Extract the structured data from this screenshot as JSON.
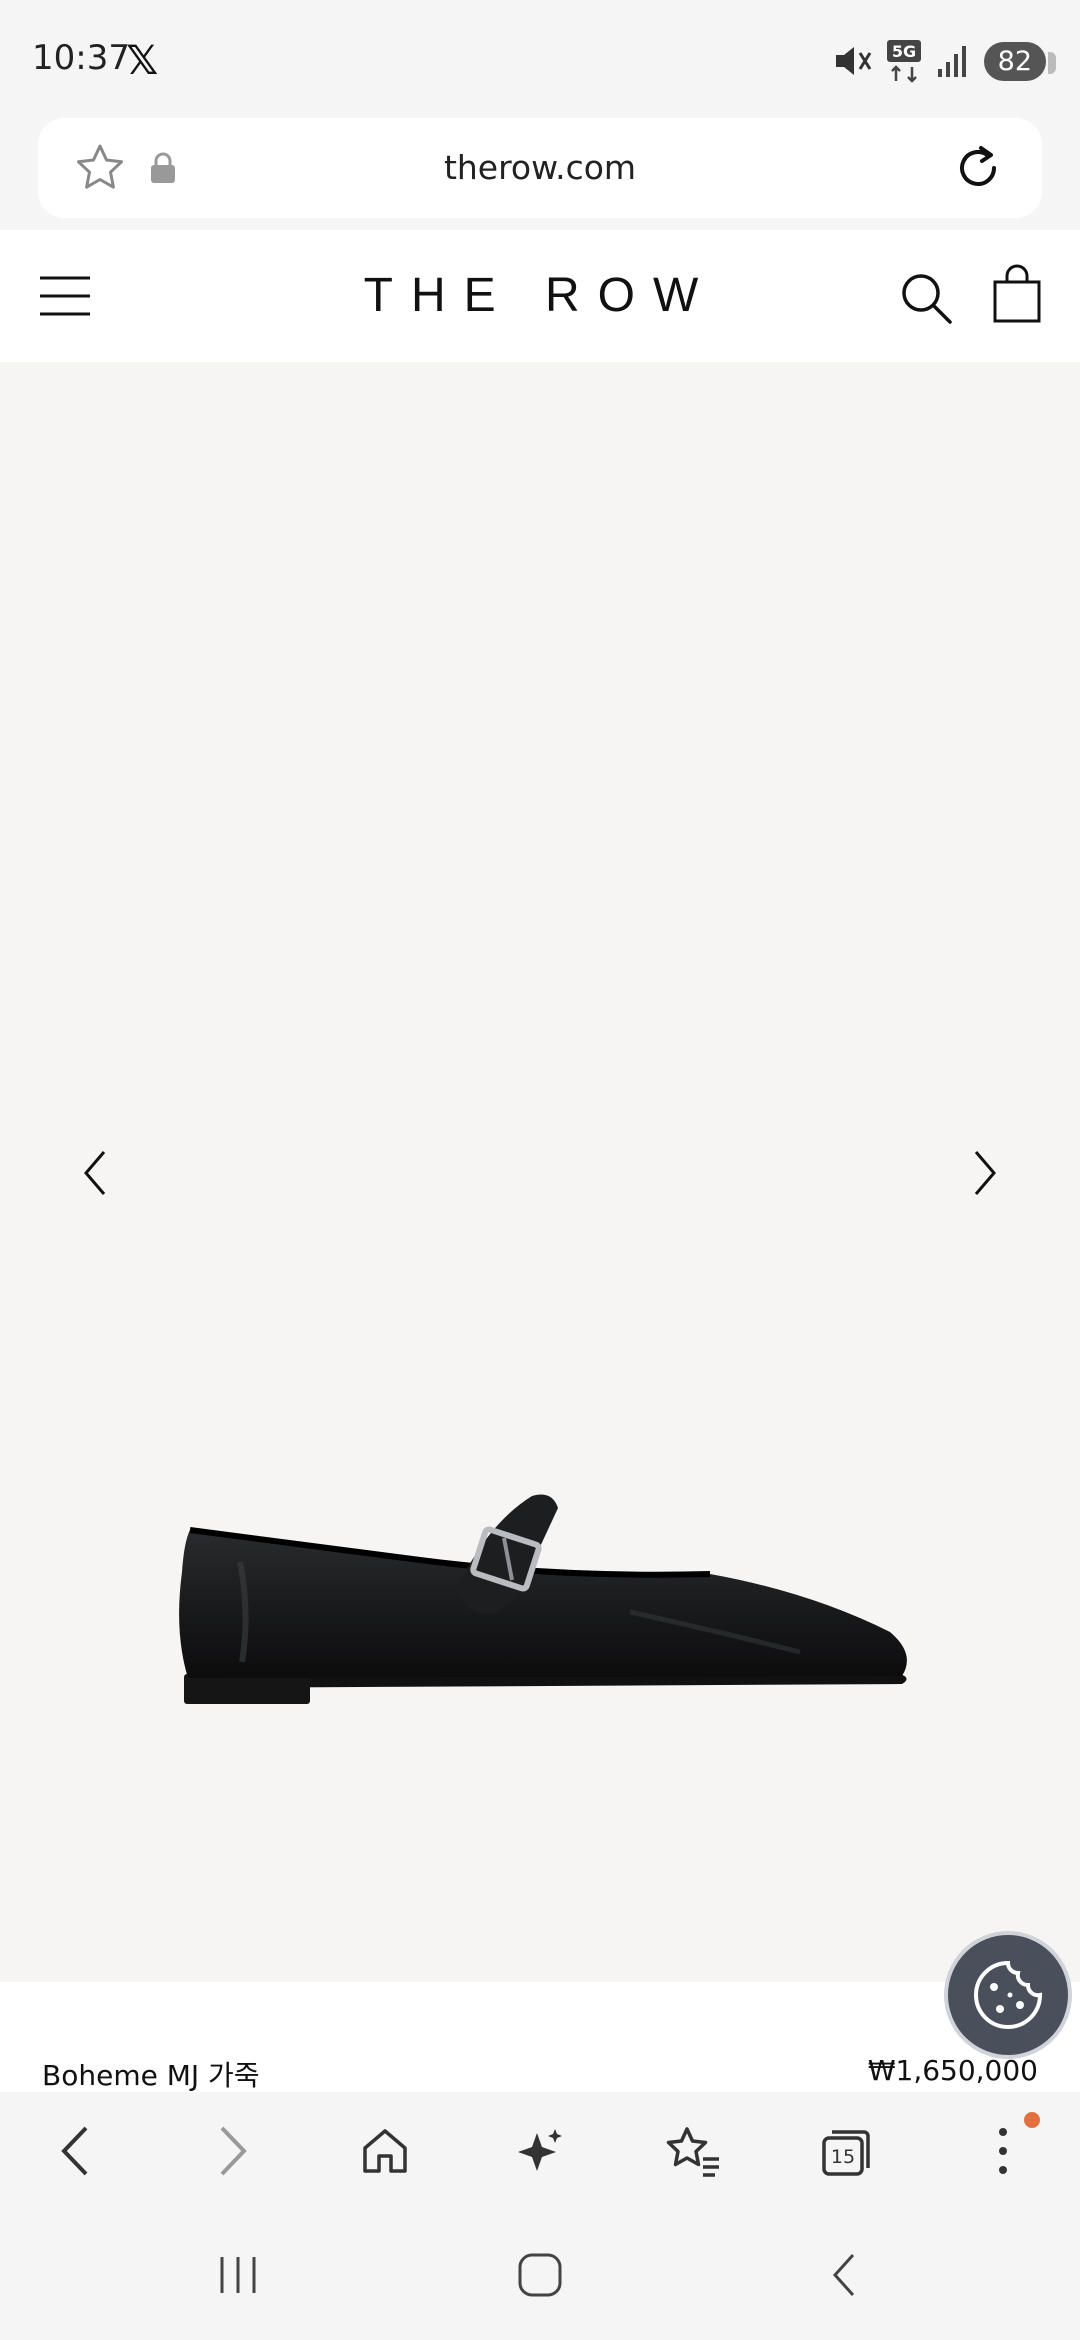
{
  "status_bar": {
    "time": "10:37",
    "app_icon": "x-logo-icon",
    "network": "5G",
    "battery": "82"
  },
  "browser": {
    "url": "therow.com",
    "tab_count": "15"
  },
  "site": {
    "brand": "THE ROW"
  },
  "product": {
    "name": "Boheme MJ 가죽",
    "price": "₩1,650,000",
    "image": "black-leather-mary-jane-flat"
  },
  "colors": {
    "background": "#f5f5f5",
    "gallery_bg": "#f6f5f4",
    "cookie_button": "#4a4f5c",
    "notification_dot": "#e07040"
  }
}
